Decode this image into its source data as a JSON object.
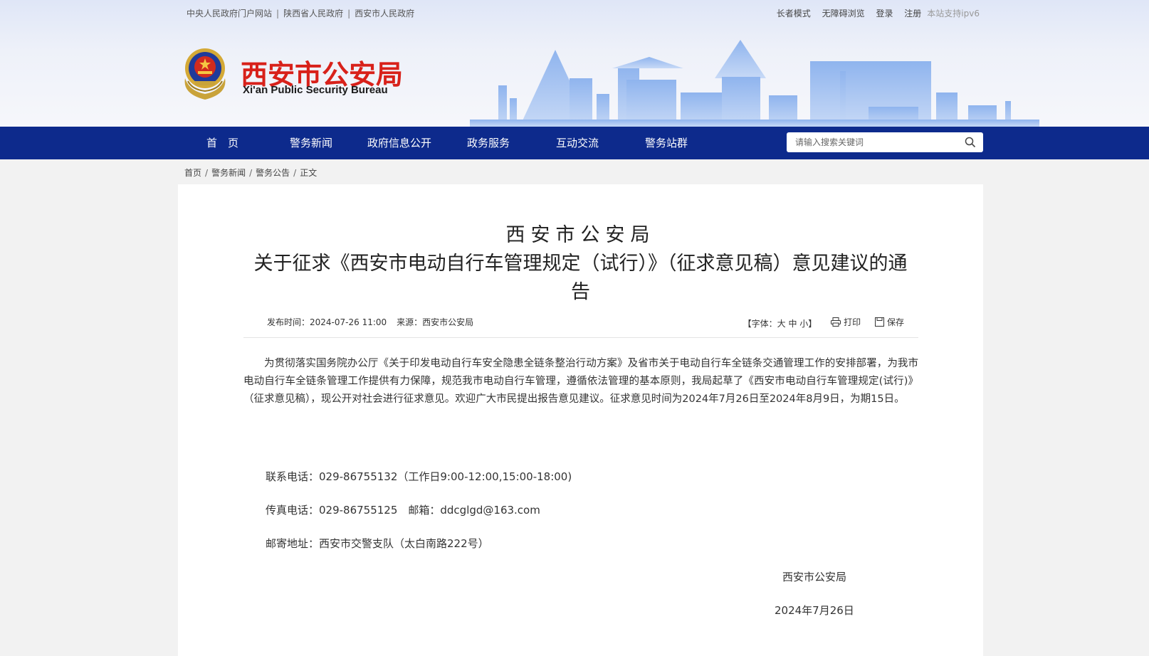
{
  "topbar": {
    "links": [
      "中央人民政府门户网站",
      "陕西省人民政府",
      "西安市人民政府"
    ],
    "right": {
      "elder_mode": "长者模式",
      "accessible": "无障碍浏览",
      "login": "登录",
      "register": "注册",
      "ipv6": "本站支持ipv6"
    }
  },
  "logo": {
    "cn": "西安市公安局",
    "en": "Xi'an Public Security Bureau"
  },
  "nav": {
    "items": [
      "首　页",
      "警务新闻",
      "政府信息公开",
      "政务服务",
      "互动交流",
      "警务站群"
    ]
  },
  "search": {
    "placeholder": "请输入搜索关键词"
  },
  "breadcrumb": [
    "首页",
    "警务新闻",
    "警务公告",
    "正文"
  ],
  "article": {
    "title_line1": "西安市公安局",
    "title_line2": "关于征求《西安市电动自行车管理规定（试行）》（征求意见稿）意见建议的通告",
    "publish_label": "发布时间：",
    "publish_time": "2024-07-26 11:00",
    "source_label": "来源：",
    "source": "西安市公安局",
    "font_label": "【字体：",
    "font_large": "大",
    "font_medium": "中",
    "font_small": "小",
    "font_close": "】",
    "print": "打印",
    "save": "保存",
    "body": "为贯彻落实国务院办公厅《关于印发电动自行车安全隐患全链条整治行动方案》及省市关于电动自行车全链条交通管理工作的安排部署，为我市电动自行车全链条管理工作提供有力保障，规范我市电动自行车管理，遵循依法管理的基本原则，我局起草了《西安市电动自行车管理规定(试行)》（征求意见稿），现公开对社会进行征求意见。欢迎广大市民提出报告意见建议。征求意见时间为2024年7月26日至2024年8月9日，为期15日。",
    "phone": "联系电话：029-86755132（工作日9:00-12:00,15:00-18:00)",
    "fax": "传真电话：029-86755125　邮箱：ddcglgd@163.com",
    "address": "邮寄地址：西安市交警支队（太白南路222号）",
    "signature": "西安市公安局",
    "date": "2024年7月26日"
  },
  "colors": {
    "nav_bg": "#0d2a8c",
    "logo_red": "#d8211a",
    "page_bg": "#f2f2f2"
  }
}
